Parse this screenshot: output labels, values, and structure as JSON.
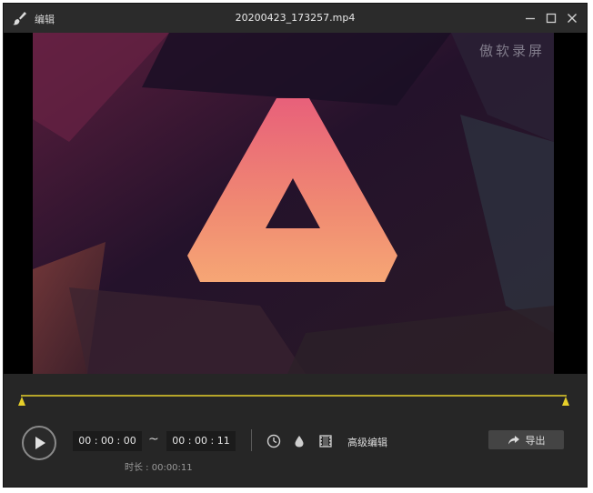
{
  "app": {
    "name": "编辑",
    "file_title": "20200423_173257.mp4",
    "icon": "brush-icon"
  },
  "window_controls": [
    "minimize-icon",
    "maximize-icon",
    "close-icon"
  ],
  "video": {
    "watermark": "傲软录屏"
  },
  "controls": {
    "start_time": "00 : 00 : 00",
    "separator": "~",
    "end_time": "00 : 00 : 11",
    "duration_label": "时长 : 00:00:11",
    "advanced_edit_label": "高级编辑",
    "export_label": "导出",
    "trim_range": [
      0.0,
      1.0
    ]
  },
  "colors": {
    "timeline_accent": "#e6cf2a",
    "background": "#262626",
    "titlebar": "#2b2b2b"
  }
}
